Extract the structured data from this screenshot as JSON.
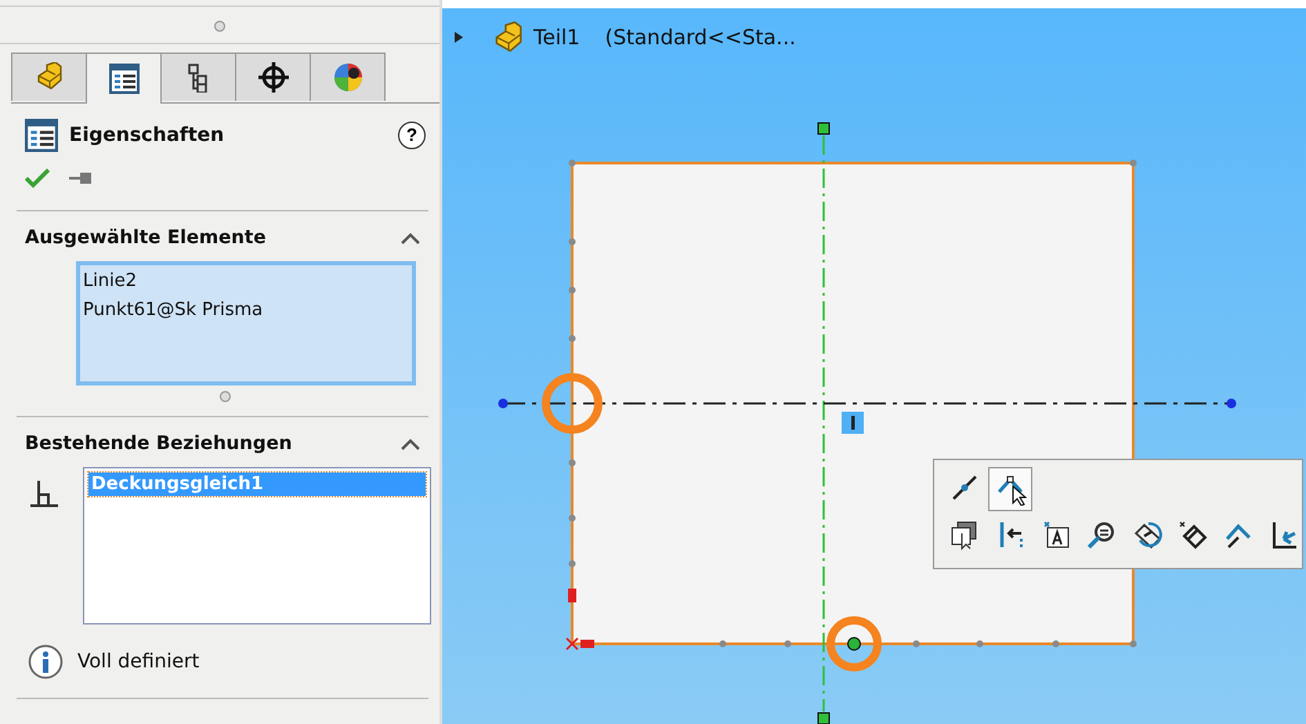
{
  "panel": {
    "tabs": [
      {
        "kind": "part",
        "selected": false
      },
      {
        "kind": "properties",
        "selected": true
      },
      {
        "kind": "config",
        "selected": false
      },
      {
        "kind": "target",
        "selected": false
      },
      {
        "kind": "appearance",
        "selected": false
      }
    ],
    "title": "Eigenschaften",
    "help": "?",
    "sections": [
      {
        "kind": "selection",
        "title": "Ausgewählte Elemente",
        "expanded": true,
        "items": [
          {
            "label": "Linie2"
          },
          {
            "label": "Punkt61@Sk Prisma"
          }
        ]
      },
      {
        "kind": "relations",
        "title": "Bestehende Beziehungen",
        "expanded": true,
        "items": [
          {
            "label": "Deckungsgleich1",
            "selected": true
          }
        ]
      }
    ],
    "status": "Voll definiert"
  },
  "canvas": {
    "breadcrumb": {
      "name": "Teil1",
      "config": "(Standard<<Sta..."
    },
    "toolbar": {
      "rows": [
        [
          {
            "kind": "line",
            "selected": false
          },
          {
            "kind": "angle",
            "selected": true
          }
        ],
        [
          {
            "kind": "select",
            "selected": false
          },
          {
            "kind": "align",
            "selected": false
          },
          {
            "kind": "note",
            "selected": false
          },
          {
            "kind": "zoom",
            "selected": false
          },
          {
            "kind": "rotate",
            "selected": false
          },
          {
            "kind": "dimension",
            "selected": false
          },
          {
            "kind": "smart",
            "selected": false
          },
          {
            "kind": "exit",
            "selected": false
          }
        ]
      ]
    }
  }
}
